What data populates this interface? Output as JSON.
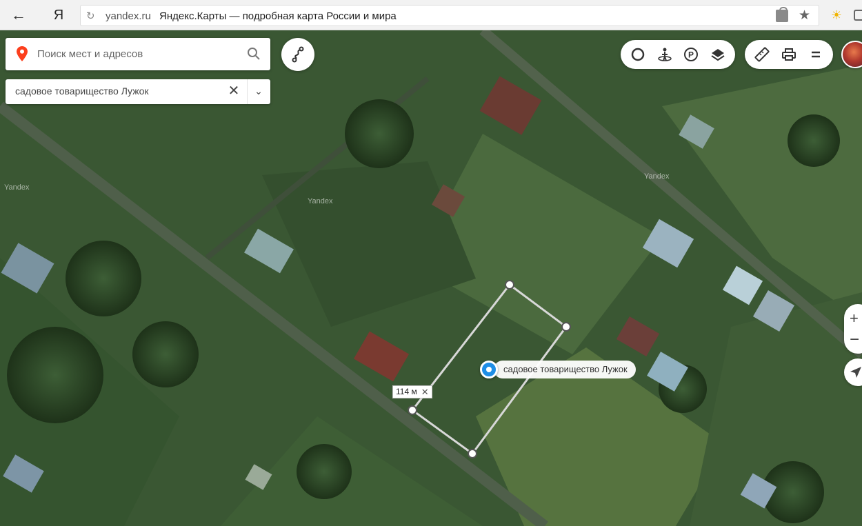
{
  "browser": {
    "back_glyph": "←",
    "logo_glyph": "Я",
    "reload_glyph": "↻",
    "url_domain": "yandex.ru",
    "page_title": "Яндекс.Карты — подробная карта России и мира",
    "star_glyph": "★",
    "weather_glyph": "☀"
  },
  "search": {
    "placeholder": "Поиск мест и адресов"
  },
  "result": {
    "text": "садовое товарищество Лужок",
    "clear_glyph": "✕",
    "chevron_glyph": "⌄"
  },
  "toolbar": {
    "layers": [
      "traffic-icon",
      "panorama-icon",
      "parking-icon",
      "map-layers-icon"
    ],
    "tools": [
      "ruler-icon",
      "print-icon",
      "menu-icon"
    ]
  },
  "controls": {
    "zoom_in_glyph": "+",
    "zoom_out_glyph": "−"
  },
  "map": {
    "watermark": "Yandex",
    "place_label": "садовое товарищество Лужок",
    "distance_label": "114 м",
    "distance_close_glyph": "✕",
    "marker_color": "#1f8ee6"
  }
}
